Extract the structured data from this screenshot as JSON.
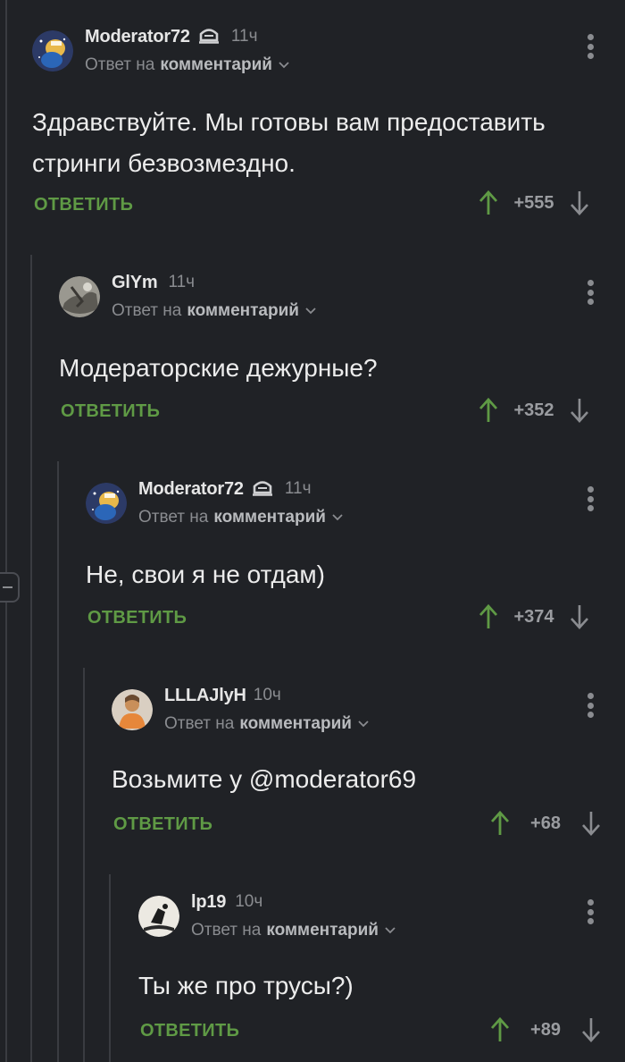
{
  "colors": {
    "background": "#202226",
    "accent_green": "#5f9a45",
    "muted_text": "#8a8c90",
    "thread_line": "#3a3c41"
  },
  "comments": [
    {
      "username": "Moderator72",
      "moderator_badge": true,
      "time": "11ч",
      "reply_prefix": "Ответ на",
      "reply_target": "комментарий",
      "text_lines": [
        "Здравствуйте. Мы готовы вам предоставить",
        "стринги безвозмездно."
      ],
      "reply_label": "ОТВЕТИТЬ",
      "score": "+555",
      "avatar": "moderator-avatar-icon"
    },
    {
      "username": "GlYm",
      "moderator_badge": false,
      "time": "11ч",
      "reply_prefix": "Ответ на",
      "reply_target": "комментарий",
      "text_lines": [
        "Модераторские дежурные?"
      ],
      "reply_label": "ОТВЕТИТЬ",
      "score": "+352",
      "avatar": "user-avatar-icon"
    },
    {
      "username": "Moderator72",
      "moderator_badge": true,
      "time": "11ч",
      "reply_prefix": "Ответ на",
      "reply_target": "комментарий",
      "text_lines": [
        "Не, свои я не отдам)"
      ],
      "reply_label": "ОТВЕТИТЬ",
      "score": "+374",
      "avatar": "moderator-avatar-icon"
    },
    {
      "username": "LLLAJlyH",
      "moderator_badge": false,
      "time": "10ч",
      "reply_prefix": "Ответ на",
      "reply_target": "комментарий",
      "text_lines": [
        "Возьмите у @moderator69"
      ],
      "reply_label": "ОТВЕТИТЬ",
      "score": "+68",
      "avatar": "user-avatar-icon"
    },
    {
      "username": "lp19",
      "moderator_badge": false,
      "time": "10ч",
      "reply_prefix": "Ответ на",
      "reply_target": "комментарий",
      "text_lines": [
        "Ты же про трусы?)"
      ],
      "reply_label": "ОТВЕТИТЬ",
      "score": "+89",
      "avatar": "user-avatar-icon"
    }
  ]
}
